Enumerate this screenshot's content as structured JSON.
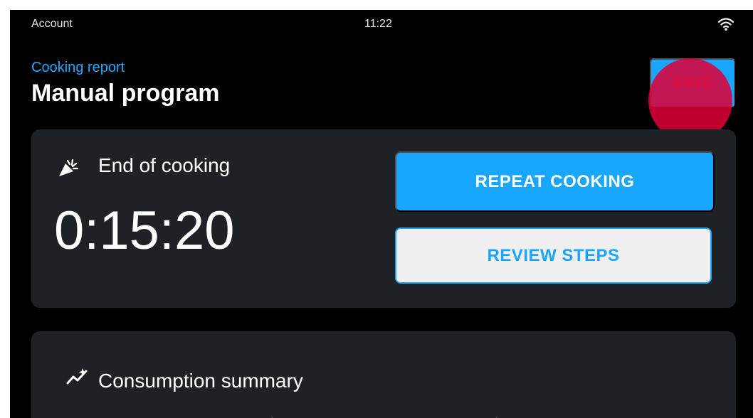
{
  "status_bar": {
    "account": "Account",
    "time": "11:22",
    "wifi_icon": "wifi-icon"
  },
  "header": {
    "subtitle": "Cooking report",
    "title": "Manual program",
    "save_label": "SAVE"
  },
  "cooking": {
    "label": "End of cooking",
    "timer": "0:15:20",
    "icon": "party-popper-icon",
    "repeat_label": "REPEAT COOKING",
    "review_label": "REVIEW STEPS"
  },
  "summary": {
    "label": "Consumption summary",
    "icon": "analytics-icon"
  },
  "colors": {
    "background": "#000000",
    "card": "#1e2126",
    "accent": "#18a6ff",
    "touch_indicator": "#de0037"
  }
}
